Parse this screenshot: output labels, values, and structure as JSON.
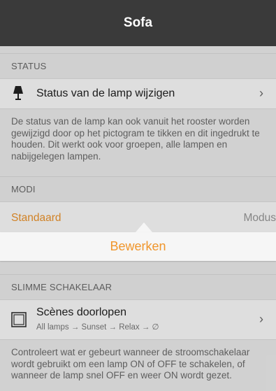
{
  "header": {
    "title": "Sofa"
  },
  "status_section": {
    "title": "STATUS",
    "row_label": "Status van de lamp wijzigen",
    "chevron": "›",
    "description": "De status van de lamp kan ook vanuit het rooster worden gewijzigd door op het pictogram te tikken en dit ingedrukt te houden. Dit werkt ook voor groepen, alle lampen en nabijgelegen lampen."
  },
  "modi_section": {
    "title": "MODI",
    "selected": "Standaard",
    "right_label": "Modus",
    "accent_color": "#f0962c"
  },
  "popup": {
    "label": "Bewerken"
  },
  "switch_section": {
    "title": "SLIMME SCHAKELAAR",
    "row_title": "Scènes doorlopen",
    "row_subtitle": "All lamps → Sunset → Relax → ∅",
    "chevron": "›",
    "description": "Controleert wat er gebeurt wanneer de stroomschakelaar wordt gebruikt om een lamp ON of OFF te schakelen, of wanneer de lamp snel OFF en weer ON wordt gezet."
  },
  "icons": {
    "lamp": "lamp-icon",
    "chevron": "chevron-right-icon",
    "checkbox": "checkbox-icon"
  }
}
